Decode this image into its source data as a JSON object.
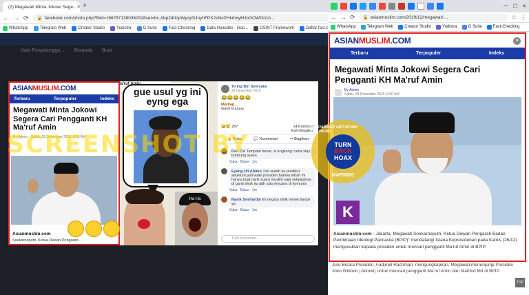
{
  "left_browser": {
    "tab_title": "(2) Megawati Minta Jokowi Sege...",
    "new_tab": "+",
    "url": "facebook.com/photo.php?fbid=1667871380361528set=bc.Abp240opWyopSJnyhFPX2sNoZHkrbxy6UoGOWOn1b...",
    "bookmarks": [
      "WhatsApp",
      "Telegram Web",
      "Creator Studio",
      "Yudistra",
      "G Suite",
      "Fact-Checking",
      "Data Hoaxdes - Goo...",
      "OSINT Framework",
      "Daftar fact-checking"
    ],
    "fb_menu": [
      "Halo Penyatunggu...",
      "Beranda",
      "Buat"
    ],
    "article": {
      "logo_a": "ASIAN",
      "logo_b": "MUSLIM",
      "logo_c": ".COM",
      "nav": [
        "Terbaru",
        "Terpopuler",
        "Indeks"
      ],
      "title": "Megawati Minta Jokowi Segera Cari Pengganti KH Ma'ruf Amin",
      "byline": "By Admin",
      "date": "Sabtu, 28 Desember 2019, 6:50 AM",
      "footer_site": "Asianmuslim.com",
      "footer_text": "Soekarnoputri, Ketua Dewan Pengarah..."
    },
    "meme": {
      "caption": "gue usul yg ini eyng ega",
      "top_overlay": "Segera Cari Pengganti KH Ma'ruf Amin",
      "haha": "Ha Ha"
    },
    "post": {
      "author": "To'ing Bin Semvake",
      "date": "28 Desember 2019",
      "emojis": "😂😂😂😂😂",
      "comment_author": "Marliap...",
      "comment_text": "Ganti truuuus",
      "reaction_count": "287",
      "comment_count": "14 Komentar",
      "share_count": "Kali dibagikan",
      "actions": [
        "Suka",
        "Komentari",
        "Bagikan"
      ],
      "comments": [
        {
          "name": "Den Zul",
          "text": "Tampate benar, si engkong cuma stay tumbung suara",
          "meta": "Suka · Balas · 1m"
        },
        {
          "name": "Eyang Utl Abitan",
          "text": "Tuh sudah ku prediksi sebelum jadi wakil presiden bahwa mbah ini hanya buat narik suara muslim saja selanjutnya di ganti ahok itu adh ada rencana di komunis",
          "meta": "Suka · Balas · 1m"
        },
        {
          "name": "Nasik Soehardjo",
          "text": "Ini negara milik nenek lampir ya",
          "meta": "Suka · Balas · 1m"
        }
      ],
      "comment_placeholder": "Tulis komentar..."
    }
  },
  "right_browser": {
    "url": "asianmuslim.com/2019/12/megawati-...",
    "bookmarks": [
      "WhatsApp",
      "Telegram Web",
      "Creator Studio",
      "Yudistra",
      "G Suite",
      "Fact-Checking"
    ],
    "logo_a": "ASIAN",
    "logo_b": "MUSLIM",
    "logo_c": ".COM",
    "nav": [
      "Terbaru",
      "Terpopuler",
      "Indeks"
    ],
    "title": "Megawati Minta Jokowi Segera Cari Pengganti KH Ma'ruf Amin",
    "byline": "By Admin",
    "date": "Sabtu, 28 Desember 2019, 6:50 AM",
    "body_site": "Asianmuslim.com",
    "body": " - Jakarta, Megawati Soekarnoputri, Ketua Dewan Pengarah Badan Pembinaan Ideologi Pancasila (BPIP)\" mendatangi Istana Kepresidenan pada Kamis (26/12) mengusulkan kepada presiden untuk mencari pengganti Ma'ruf Amin di BPIP.",
    "below": "Juru Bicara Presiden, Fadjroel Rachman, mengungkapkan, Megawati menunjungi Presiden Joko Widodo (Jokowi) untuk mencari pengganti Ma'ruf Amin dan Mahfud Md di BPIP.",
    "top_button": "TOP"
  },
  "overlay": {
    "watermark": "SCREENSHOT BY",
    "seal_ring": "MASYARAKAT ANTI FITNAH INDONESIA",
    "seal_line1": "TURN",
    "seal_line2": "BACK",
    "seal_line3": "HOAX",
    "seal_bottom": "MAFINDO"
  },
  "colors": {
    "frame": "#e02020",
    "brand_blue": "#1b3ba8",
    "seal": "#ebbe14"
  }
}
